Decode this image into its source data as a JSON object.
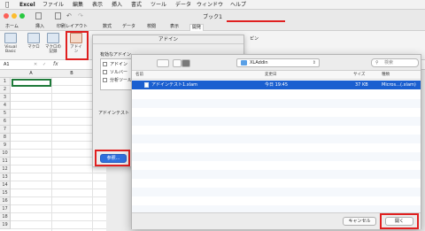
{
  "menubar": {
    "apple": "",
    "items": [
      "Excel",
      "ファイル",
      "編集",
      "表示",
      "挿入",
      "書式",
      "ツール",
      "データ",
      "ウィンドウ",
      "ヘルプ"
    ]
  },
  "window": {
    "title": "ブック1"
  },
  "ribbon": {
    "tabs": [
      "ホーム",
      "挿入",
      "印刷レイアウト",
      "数式",
      "データ",
      "校閲",
      "表示",
      "開発"
    ],
    "active_tab": "開発",
    "buttons": [
      {
        "label": "Visual Basic"
      },
      {
        "label": "マクロ"
      },
      {
        "label": "マクロの記録"
      },
      {
        "label": "アドイン"
      }
    ],
    "right_fragment": "ピン"
  },
  "formula_bar": {
    "cell_ref": "A1",
    "fx": "fx"
  },
  "sheet": {
    "columns": [
      "A",
      "B"
    ],
    "rows": [
      "1",
      "2",
      "3",
      "4",
      "5",
      "6",
      "7",
      "8",
      "9",
      "10",
      "11",
      "12",
      "13",
      "14",
      "15",
      "16",
      "17",
      "18",
      "19"
    ]
  },
  "addin_dialog": {
    "title": "アドイン",
    "available_label": "有効なアドイン",
    "items": [
      {
        "label": "アドイン",
        "checked": false
      },
      {
        "label": "ソルバー",
        "checked": false
      },
      {
        "label": "分析ツール",
        "checked": false
      }
    ],
    "description_label": "アドインテスト",
    "browse_button": "参照..."
  },
  "file_dialog": {
    "location": "XLAddin",
    "search_placeholder": "検索",
    "columns": {
      "name": "名前",
      "modified": "変更日",
      "size": "サイズ",
      "kind": "種類"
    },
    "files": [
      {
        "name": "アドインテスト1.xlam",
        "modified": "今日 19:45",
        "size": "37 KB",
        "kind": "Micros…(.xlam)",
        "selected": true
      }
    ],
    "cancel_button": "キャンセル",
    "open_button": "開く"
  },
  "colors": {
    "accent": "#1a5fd0",
    "highlight": "#e02020",
    "selection": "#1a5fd0"
  }
}
